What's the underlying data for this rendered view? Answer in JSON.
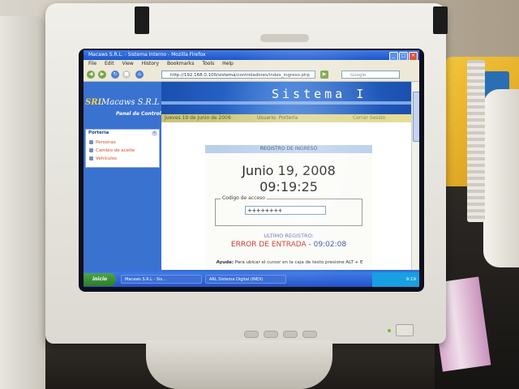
{
  "browser": {
    "window_title": "Macaws S.R.L. - Sistema Interno - Mozilla Firefox",
    "menu": [
      "File",
      "Edit",
      "View",
      "History",
      "Bookmarks",
      "Tools",
      "Help"
    ],
    "url": "http://192.168.0.100/sistema/controladores/index_ingreso.php",
    "search_placeholder": "Google"
  },
  "sidebar": {
    "logo_mark": "SRL",
    "logo_text": "Macaws S.R.L",
    "logo_subtitle": "Panel de Control",
    "panel_title": "Portería",
    "items": [
      "Personas",
      "Cambio de aceite",
      "Vehículos"
    ]
  },
  "header": {
    "title": "Sistema I",
    "date_text": "Jueves 19 de Junio de 2008",
    "user_text": "Usuario: Portería",
    "logout_text": "Cerrar Sesión"
  },
  "login": {
    "heading": "REGISTRO DE INGRESO",
    "date": "Junio 19, 2008",
    "time": "09:19:25",
    "access_label": "Codigo de acceso",
    "access_value": "++++++++",
    "last_record_label": "ULTIMO REGISTRO:",
    "error_text": "ERROR DE ENTRADA",
    "error_time": "- 09:02:08",
    "help_label": "Ayuda:",
    "help_text": "Para ubicar el cursor en la caja de texto presione ALT + E"
  },
  "taskbar": {
    "start_label": "inicio",
    "items": [
      "Macaws S.R.L - Sis...",
      "ARL Sistema Digital (INEX)"
    ],
    "clock": "9:19"
  },
  "colors": {
    "header_blue": "#2f73d6",
    "error_red": "#c9382c",
    "status_band": "#e5df98",
    "taskbar_blue": "#2453c7"
  }
}
